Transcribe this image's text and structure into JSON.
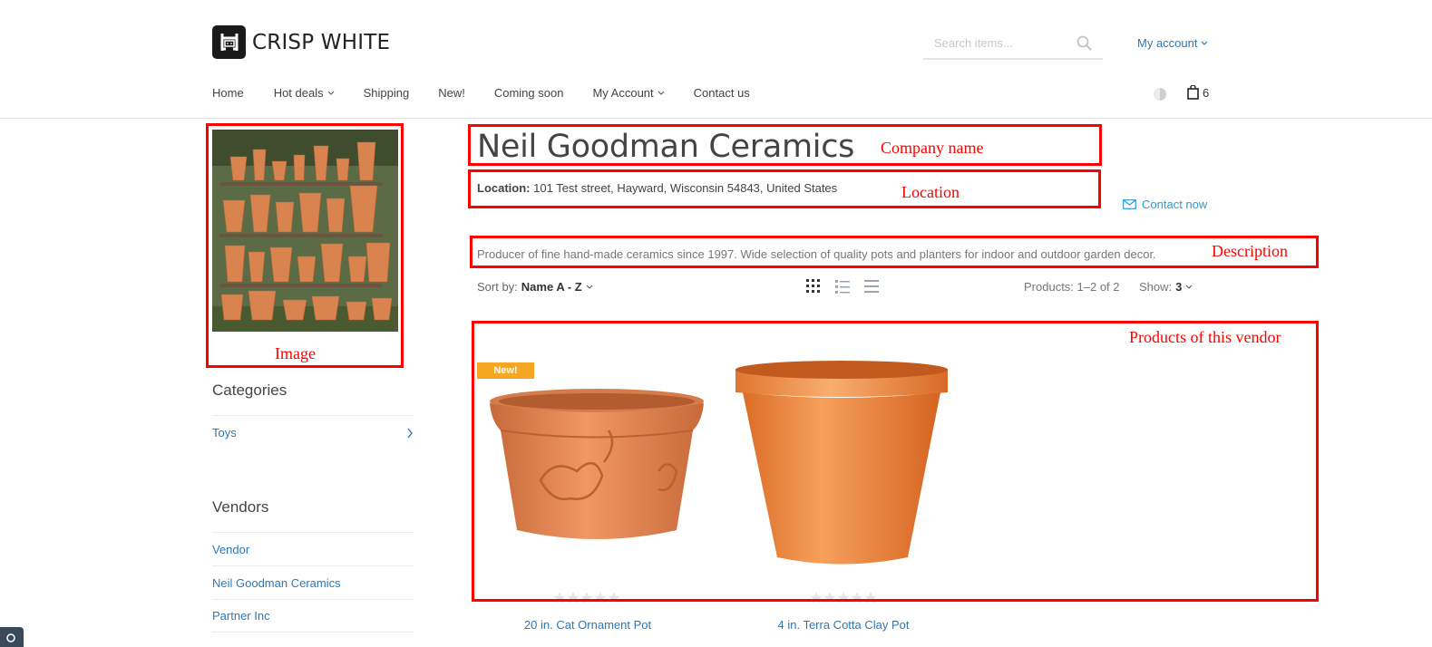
{
  "header": {
    "logo_text": "CRISP WHITE",
    "search_placeholder": "Search items...",
    "my_account_label": "My account",
    "cart_count": "6"
  },
  "nav": {
    "items": [
      {
        "label": "Home"
      },
      {
        "label": "Hot deals"
      },
      {
        "label": "Shipping"
      },
      {
        "label": "New!"
      },
      {
        "label": "Coming soon"
      },
      {
        "label": "My Account"
      },
      {
        "label": "Contact us"
      }
    ]
  },
  "vendor": {
    "name": "Neil Goodman Ceramics",
    "location_label": "Location:",
    "location_value": "101 Test street, Hayward, Wisconsin 54843, United States",
    "contact_label": "Contact now",
    "description": "Producer of fine hand-made ceramics since 1997. Wide selection of quality pots and planters for indoor and outdoor garden decor."
  },
  "sidebar": {
    "categories_title": "Categories",
    "categories": [
      {
        "label": "Toys"
      }
    ],
    "vendors_title": "Vendors",
    "vendors": [
      {
        "label": "Vendor"
      },
      {
        "label": "Neil Goodman Ceramics"
      },
      {
        "label": "Partner Inc"
      }
    ]
  },
  "listing": {
    "sort_label": "Sort by:",
    "sort_value": "Name A - Z",
    "products_count": "Products: 1–2 of 2",
    "show_label": "Show:",
    "show_value": "3"
  },
  "products": [
    {
      "name": "20 in. Cat Ornament Pot",
      "badge": "New!",
      "rating": 0
    },
    {
      "name": "4 in. Terra Cotta Clay Pot",
      "rating": 0
    }
  ],
  "annotations": {
    "company_name": "Company name",
    "location": "Location",
    "description": "Description",
    "image": "Image",
    "products": "Products of this vendor"
  },
  "colors": {
    "accent": "#2c77b8",
    "annotation": "#ff0000",
    "badge": "#f5a623",
    "terracotta": "#e8834a"
  }
}
